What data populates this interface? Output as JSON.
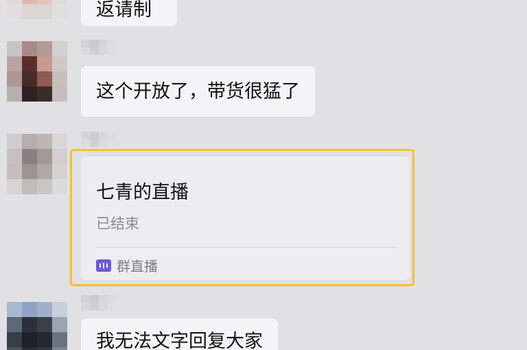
{
  "messages": [
    {
      "text": "返请制"
    },
    {
      "text": "这个开放了，带货很猛了"
    },
    {
      "text": "我无法文字回复大家"
    }
  ],
  "live_card": {
    "title": "七青的直播",
    "status": "已结束",
    "source_label": "群直播",
    "source_icon": "live-stream-icon"
  },
  "colors": {
    "background": "#e1e1e3",
    "bubble": "#f4f4f6",
    "highlight_border": "#f6c02b",
    "live_icon": "#6b5bd6",
    "muted_text": "#8a8a8f"
  }
}
